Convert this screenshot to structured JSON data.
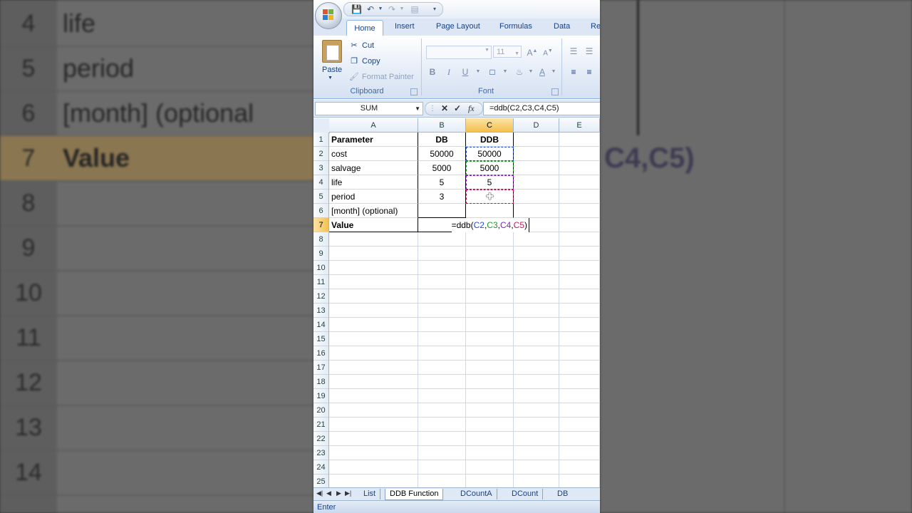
{
  "background": {
    "left_rows": [
      {
        "num": "4",
        "text": "life"
      },
      {
        "num": "5",
        "text": "period"
      },
      {
        "num": "6",
        "text": "[month] (optional"
      },
      {
        "num": "7",
        "text": "Value"
      },
      {
        "num": "8",
        "text": ""
      },
      {
        "num": "9",
        "text": ""
      },
      {
        "num": "10",
        "text": ""
      },
      {
        "num": "11",
        "text": ""
      },
      {
        "num": "12",
        "text": ""
      },
      {
        "num": "13",
        "text": ""
      },
      {
        "num": "14",
        "text": ""
      }
    ],
    "right_formula": "C4,C5)"
  },
  "ribbon": {
    "tabs": [
      "Home",
      "Insert",
      "Page Layout",
      "Formulas",
      "Data",
      "Re"
    ],
    "clipboard": {
      "paste": "Paste",
      "cut": "Cut",
      "copy": "Copy",
      "format_painter": "Format Painter",
      "label": "Clipboard"
    },
    "font": {
      "size": "11",
      "label": "Font",
      "bold": "B",
      "italic": "I",
      "underline": "U"
    }
  },
  "formula_bar": {
    "name_box": "SUM",
    "fx": "fx",
    "formula": "=ddb(C2,C3,C4,C5)"
  },
  "columns": [
    "A",
    "B",
    "C",
    "D",
    "E"
  ],
  "rows": [
    {
      "num": "1",
      "a": "Parameter",
      "b": "DB",
      "c": "DDB"
    },
    {
      "num": "2",
      "a": "cost",
      "b": "50000",
      "c": "50000"
    },
    {
      "num": "3",
      "a": "salvage",
      "b": "5000",
      "c": "5000"
    },
    {
      "num": "4",
      "a": "life",
      "b": "5",
      "c": "5"
    },
    {
      "num": "5",
      "a": "period",
      "b": "3",
      "c": ""
    },
    {
      "num": "6",
      "a": "[month] (optional)",
      "b": "",
      "c": ""
    },
    {
      "num": "7",
      "a": "Value",
      "b": "",
      "c": "=ddb(C2,C3,C4,C5)"
    }
  ],
  "empty_rows": [
    "8",
    "9",
    "10",
    "11",
    "12",
    "13",
    "14",
    "15",
    "16",
    "17",
    "18",
    "19",
    "20",
    "21",
    "22",
    "23",
    "24",
    "25"
  ],
  "sheet_tabs": [
    "List",
    "DDB Function",
    "DCountA",
    "DCount",
    "DB Functio"
  ],
  "active_sheet": "DDB Function",
  "status": "Enter",
  "colors": {
    "ref_c2": "#1f4fd6",
    "ref_c3": "#1a9a2a",
    "ref_c4": "#8a1cc7",
    "ref_c5": "#c2185b",
    "selected_header": "#f4c04f"
  }
}
